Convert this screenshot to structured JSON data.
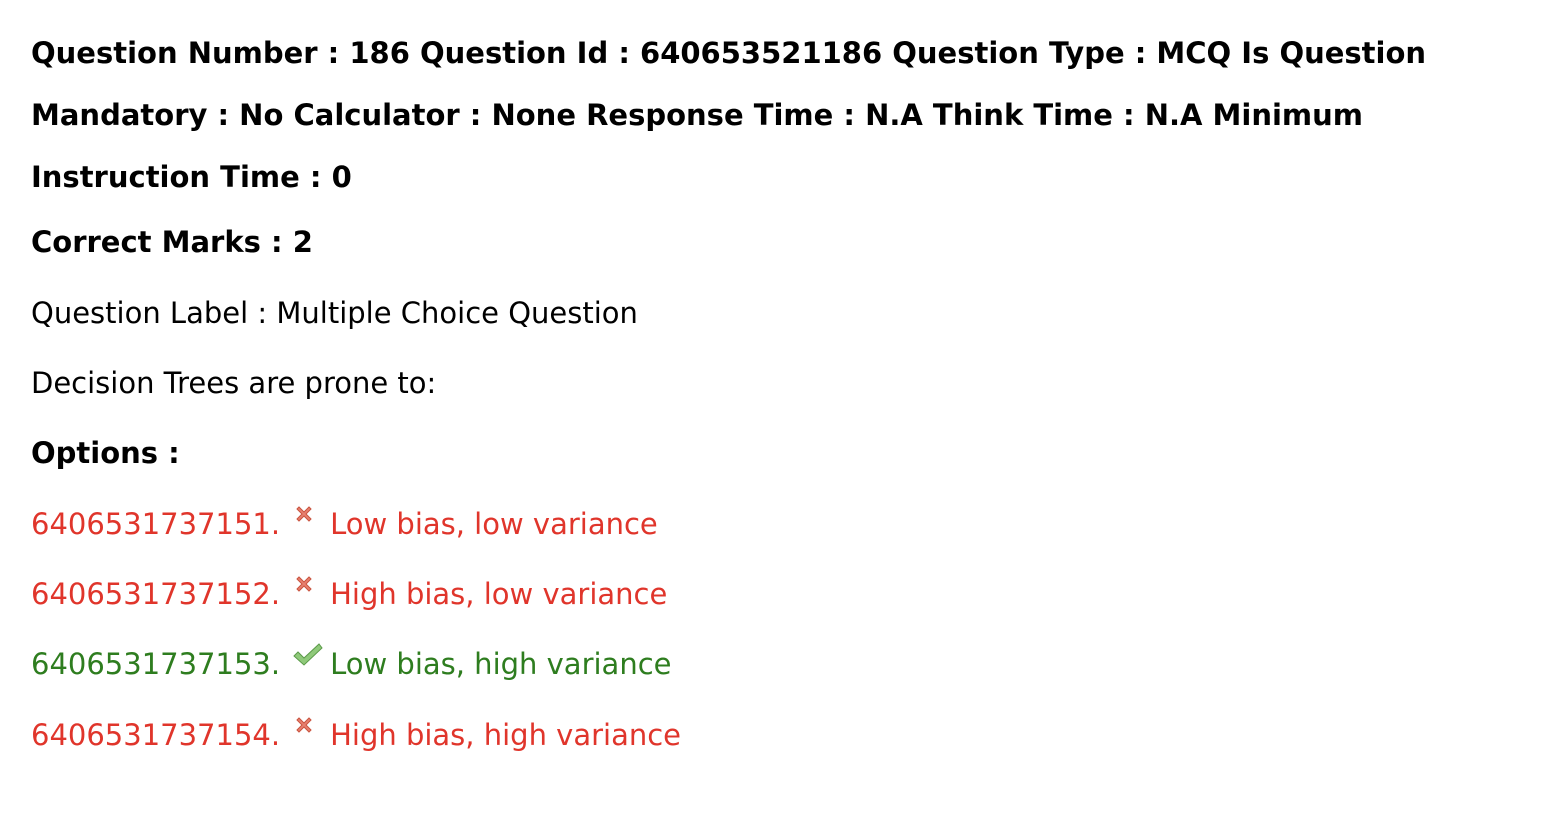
{
  "header": {
    "text": "Question Number : 186 Question Id : 640653521186 Question Type : MCQ Is Question Mandatory : No Calculator : None Response Time : N.A Think Time : N.A Minimum Instruction Time : 0"
  },
  "correct_marks": "Correct Marks : 2",
  "question_label": "Question Label : Multiple Choice Question",
  "question_text": "Decision Trees are prone to:",
  "options_heading": "Options :",
  "options": [
    {
      "id": "6406531737151.",
      "text": "Low bias, low variance",
      "status": "incorrect",
      "icon": "cross-icon"
    },
    {
      "id": "6406531737152.",
      "text": "High bias, low variance",
      "status": "incorrect",
      "icon": "cross-icon"
    },
    {
      "id": "6406531737153.",
      "text": "Low bias, high variance",
      "status": "correct",
      "icon": "check-icon"
    },
    {
      "id": "6406531737154.",
      "text": "High bias, high variance",
      "status": "incorrect",
      "icon": "cross-icon"
    }
  ],
  "colors": {
    "incorrect": "#e0352b",
    "correct": "#2e7d1f",
    "text": "#000000"
  }
}
